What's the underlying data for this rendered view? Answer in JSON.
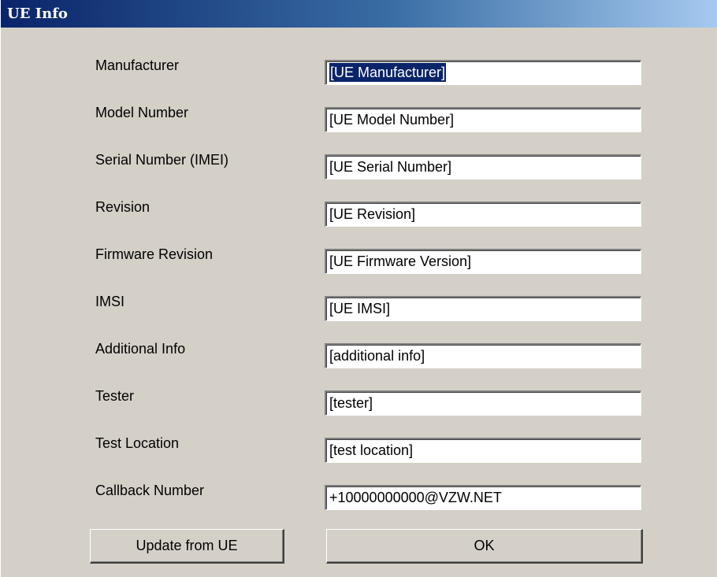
{
  "window": {
    "title": "UE Info"
  },
  "form": {
    "fields": [
      {
        "label": "Manufacturer",
        "value": "[UE Manufacturer]"
      },
      {
        "label": "Model Number",
        "value": "[UE Model Number]"
      },
      {
        "label": "Serial Number (IMEI)",
        "value": "[UE Serial Number]"
      },
      {
        "label": "Revision",
        "value": "[UE Revision]"
      },
      {
        "label": "Firmware Revision",
        "value": "[UE Firmware Version]"
      },
      {
        "label": "IMSI",
        "value": "[UE IMSI]"
      },
      {
        "label": "Additional Info",
        "value": "[additional info]"
      },
      {
        "label": "Tester",
        "value": "[tester]"
      },
      {
        "label": "Test Location",
        "value": "[test location]"
      },
      {
        "label": "Callback Number",
        "value": "+10000000000@VZW.NET"
      }
    ]
  },
  "buttons": {
    "update_label": "Update from UE",
    "ok_label": "OK"
  },
  "colors": {
    "titlebar_start": "#0a246a",
    "titlebar_end": "#a6caf0",
    "dialog_background": "#d4d0c8",
    "selection": "#0a246a"
  }
}
